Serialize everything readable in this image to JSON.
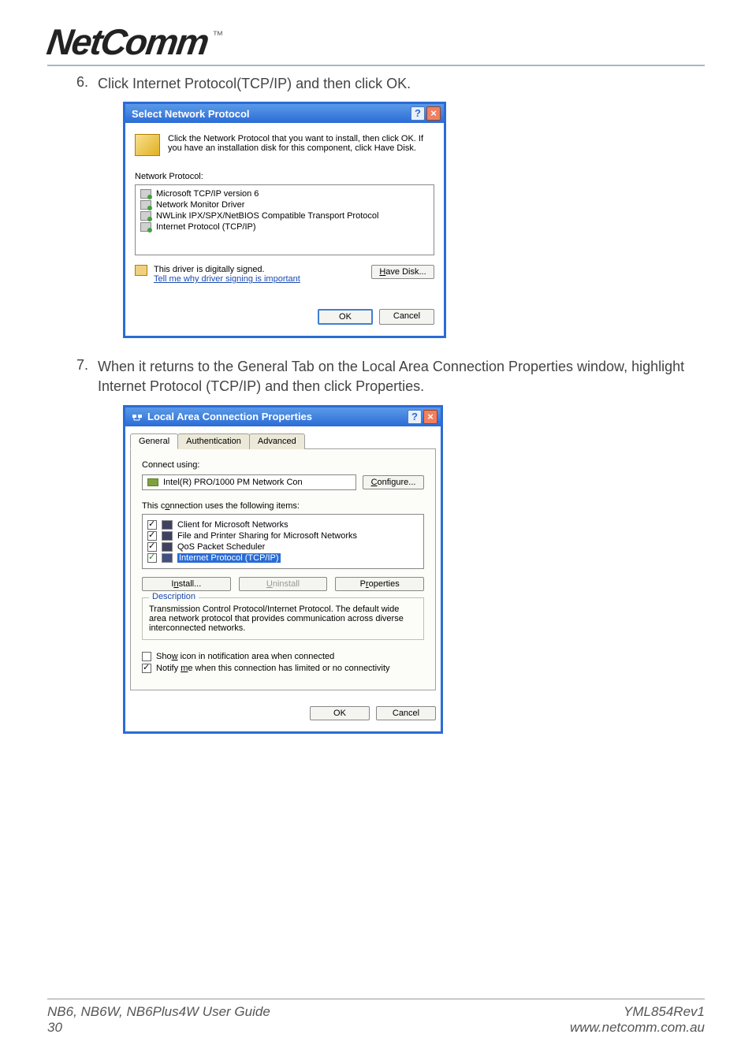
{
  "header": {
    "logo_text": "NetComm",
    "tm": "™"
  },
  "steps": {
    "s6": {
      "num": "6.",
      "text": "Click Internet Protocol(TCP/IP) and then click OK."
    },
    "s7": {
      "num": "7.",
      "text": "When it returns to the General Tab on the Local Area Connection Properties window, highlight Internet Protocol (TCP/IP) and then click Properties."
    }
  },
  "dialog1": {
    "title": "Select Network Protocol",
    "help": "?",
    "close": "×",
    "info": "Click the Network Protocol that you want to install, then click OK. If you have an installation disk for this component, click Have Disk.",
    "list_label": "Network Protocol:",
    "items": [
      "Microsoft TCP/IP version 6",
      "Network Monitor Driver",
      "NWLink IPX/SPX/NetBIOS Compatible Transport Protocol",
      "Internet Protocol (TCP/IP)"
    ],
    "signed": "This driver is digitally signed.",
    "signed_link": "Tell me why driver signing is important",
    "have_disk": "Have Disk...",
    "ok": "OK",
    "cancel": "Cancel"
  },
  "dialog2": {
    "title": "Local Area Connection Properties",
    "help": "?",
    "close": "×",
    "tabs": {
      "t1": "General",
      "t2": "Authentication",
      "t3": "Advanced"
    },
    "connect_label": "Connect using:",
    "adapter": "Intel(R) PRO/1000 PM Network Con",
    "configure": "Configure...",
    "uses_label": "This connection uses the following items:",
    "items": [
      "Client for Microsoft Networks",
      "File and Printer Sharing for Microsoft Networks",
      "QoS Packet Scheduler",
      "Internet Protocol (TCP/IP)"
    ],
    "install": "Install...",
    "uninstall": "Uninstall",
    "properties": "Properties",
    "desc_legend": "Description",
    "desc_text": "Transmission Control Protocol/Internet Protocol. The default wide area network protocol that provides communication across diverse interconnected networks.",
    "chk_show": "Show icon in notification area when connected",
    "chk_notify": "Notify me when this connection has limited or no connectivity",
    "ok": "OK",
    "cancel": "Cancel"
  },
  "footer": {
    "left1": "NB6, NB6W, NB6Plus4W User Guide",
    "left2": "30",
    "right1": "YML854Rev1",
    "right2": "www.netcomm.com.au"
  }
}
